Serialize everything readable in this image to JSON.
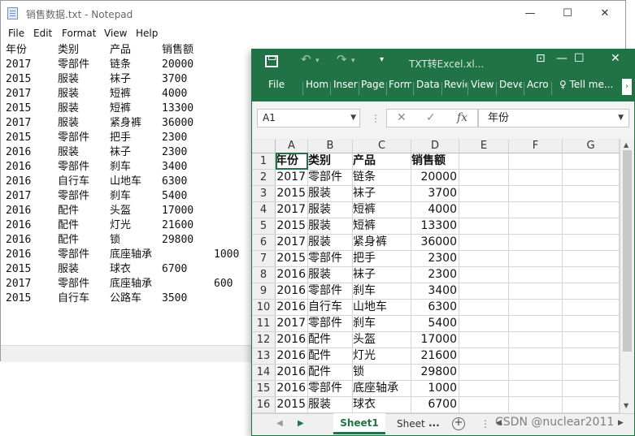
{
  "notepad": {
    "title": "销售数据.txt - Notepad",
    "controls": {
      "minimize": "—",
      "maximize": "☐",
      "close": "✕"
    },
    "menu": [
      "File",
      "Edit",
      "Format",
      "View",
      "Help"
    ],
    "lines": [
      [
        "年份",
        "类别",
        "产品",
        "销售额",
        ""
      ],
      [
        "2017",
        "零部件",
        "链条",
        "20000",
        ""
      ],
      [
        "2015",
        "服装",
        "袜子",
        "3700",
        ""
      ],
      [
        "2017",
        "服装",
        "短裤",
        "4000",
        ""
      ],
      [
        "2015",
        "服装",
        "短裤",
        "13300",
        ""
      ],
      [
        "2017",
        "服装",
        "紧身裤",
        "36000",
        ""
      ],
      [
        "2015",
        "零部件",
        "把手",
        "2300",
        ""
      ],
      [
        "2016",
        "服装",
        "袜子",
        "2300",
        ""
      ],
      [
        "2016",
        "零部件",
        "刹车",
        "3400",
        ""
      ],
      [
        "2016",
        "自行车",
        "山地车",
        "6300",
        ""
      ],
      [
        "2017",
        "零部件",
        "刹车",
        "5400",
        ""
      ],
      [
        "2016",
        "配件",
        "头盔",
        "17000",
        ""
      ],
      [
        "2016",
        "配件",
        "灯光",
        "21600",
        ""
      ],
      [
        "2016",
        "配件",
        "锁",
        "29800",
        ""
      ],
      [
        "2016",
        "零部件",
        "底座轴承",
        "",
        "1000"
      ],
      [
        "2015",
        "服装",
        "球衣",
        "6700",
        ""
      ],
      [
        "2017",
        "零部件",
        "底座轴承",
        "",
        "600"
      ],
      [
        "2015",
        "自行车",
        "公路车",
        "3500",
        ""
      ]
    ]
  },
  "excel": {
    "title": "TXT转Excel.xl...",
    "qat": {
      "undo": "↶",
      "redo": "↷",
      "customize": "▾"
    },
    "controls": {
      "ribbon_options": "⊡",
      "minimize": "—",
      "maximize": "☐",
      "close": "✕"
    },
    "tabs": [
      "File",
      "Hom",
      "Inser",
      "Page",
      "Form",
      "Data",
      "Revie",
      "View",
      "Deve",
      "Acro",
      "♀ Tell me..."
    ],
    "tab_more": "›",
    "name_box": "A1",
    "formula_value": "年份",
    "formula_buttons": {
      "cancel": "✕",
      "enter": "✓",
      "fx": "fx"
    },
    "columns": [
      "A",
      "B",
      "C",
      "D",
      "E",
      "F",
      "G"
    ],
    "rows": [
      {
        "n": "1",
        "cells": [
          "年份",
          "类别",
          "产品",
          "销售额"
        ]
      },
      {
        "n": "2",
        "cells": [
          "2017",
          "零部件",
          "链条",
          "20000"
        ]
      },
      {
        "n": "3",
        "cells": [
          "2015",
          "服装",
          "袜子",
          "3700"
        ]
      },
      {
        "n": "4",
        "cells": [
          "2017",
          "服装",
          "短裤",
          "4000"
        ]
      },
      {
        "n": "5",
        "cells": [
          "2015",
          "服装",
          "短裤",
          "13300"
        ]
      },
      {
        "n": "6",
        "cells": [
          "2017",
          "服装",
          "紧身裤",
          "36000"
        ]
      },
      {
        "n": "7",
        "cells": [
          "2015",
          "零部件",
          "把手",
          "2300"
        ]
      },
      {
        "n": "8",
        "cells": [
          "2016",
          "服装",
          "袜子",
          "2300"
        ]
      },
      {
        "n": "9",
        "cells": [
          "2016",
          "零部件",
          "刹车",
          "3400"
        ]
      },
      {
        "n": "10",
        "cells": [
          "2016",
          "自行车",
          "山地车",
          "6300"
        ]
      },
      {
        "n": "11",
        "cells": [
          "2017",
          "零部件",
          "刹车",
          "5400"
        ]
      },
      {
        "n": "12",
        "cells": [
          "2016",
          "配件",
          "头盔",
          "17000"
        ]
      },
      {
        "n": "13",
        "cells": [
          "2016",
          "配件",
          "灯光",
          "21600"
        ]
      },
      {
        "n": "14",
        "cells": [
          "2016",
          "配件",
          "锁",
          "29800"
        ]
      },
      {
        "n": "15",
        "cells": [
          "2016",
          "零部件",
          "底座轴承",
          "1000"
        ]
      },
      {
        "n": "16",
        "cells": [
          "2015",
          "服装",
          "球衣",
          "6700"
        ]
      }
    ],
    "sheet_tabs": [
      "Sheet1",
      "Sheet"
    ],
    "sheet_more": "...",
    "add_sheet": "+",
    "accent_color": "#217346"
  },
  "watermark": "CSDN @nuclear2011"
}
